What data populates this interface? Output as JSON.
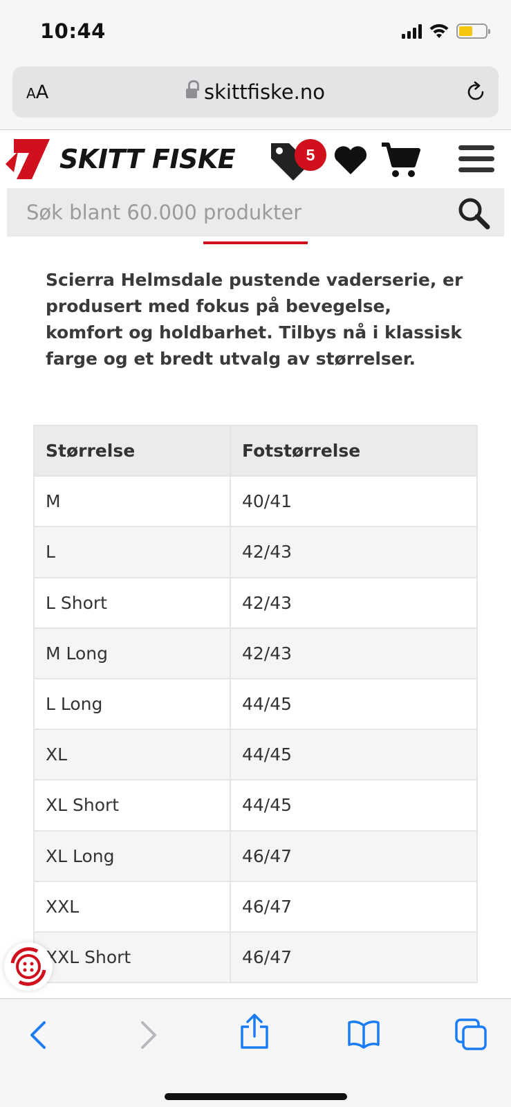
{
  "status_bar": {
    "time": "10:44"
  },
  "browser": {
    "text_size_label": "AA",
    "url": "skittfiske.no"
  },
  "site": {
    "logo_text": "SKITT FISKE",
    "deals_badge_count": "5",
    "search_placeholder": "Søk blant 60.000 produkter"
  },
  "description": "Scierra Helmsdale pustende vaderserie, er produsert med fokus på bevegelse, komfort og holdbarhet. Tilbys nå i klassisk farge og et bredt utvalg av størrelser.",
  "size_table": {
    "headers": [
      "Størrelse",
      "Fotstørrelse"
    ],
    "rows": [
      [
        "M",
        "40/41"
      ],
      [
        "L",
        "42/43"
      ],
      [
        "L Short",
        "42/43"
      ],
      [
        "M Long",
        "42/43"
      ],
      [
        "L Long",
        "44/45"
      ],
      [
        "XL",
        "44/45"
      ],
      [
        "XL Short",
        "44/45"
      ],
      [
        "XL Long",
        "46/47"
      ],
      [
        "XXL",
        "46/47"
      ],
      [
        "XXL Short",
        "46/47"
      ]
    ]
  },
  "icons": {
    "status": [
      "signal-icon",
      "wifi-icon",
      "battery-icon"
    ],
    "header": [
      "price-tag-icon",
      "heart-icon",
      "cart-icon",
      "hamburger-menu-icon"
    ],
    "search": "search-icon",
    "toolbar": [
      "back-icon",
      "forward-icon",
      "share-icon",
      "bookmarks-icon",
      "tabs-icon"
    ]
  },
  "colors": {
    "brand_red": "#d0101c",
    "ios_blue": "#1a7cf5",
    "battery_yellow": "#f5c60f"
  }
}
